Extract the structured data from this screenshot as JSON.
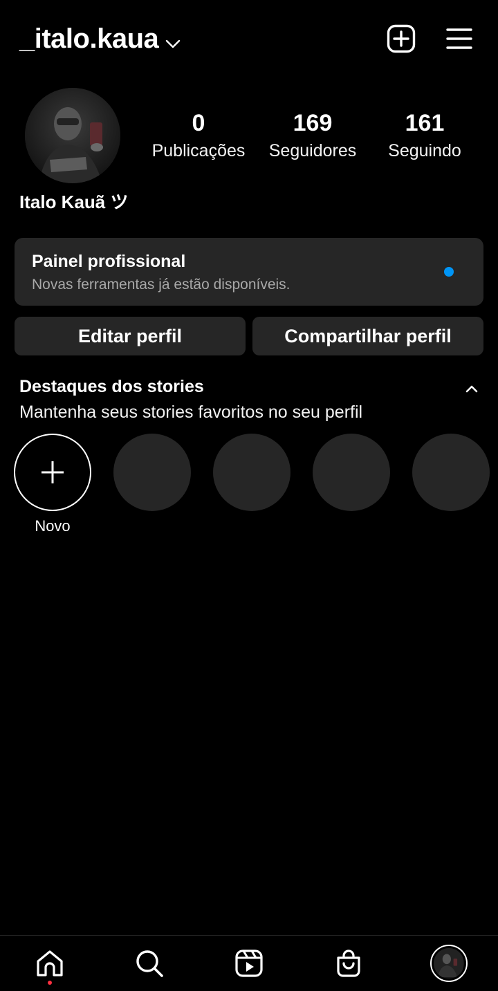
{
  "header": {
    "username": "_italo.kaua",
    "dropdown_icon": "chevron-down-icon",
    "create_icon": "plus-square-icon",
    "menu_icon": "hamburger-menu-icon"
  },
  "profile": {
    "full_name": "Italo Kauã ツ",
    "stats": [
      {
        "value": "0",
        "label": "Publicações"
      },
      {
        "value": "169",
        "label": "Seguidores"
      },
      {
        "value": "161",
        "label": "Seguindo"
      }
    ]
  },
  "professional_panel": {
    "title": "Painel profissional",
    "subtitle": "Novas ferramentas já estão disponíveis.",
    "dot_color": "#0095f6"
  },
  "actions": {
    "edit_label": "Editar perfil",
    "share_label": "Compartilhar perfil"
  },
  "highlights": {
    "title": "Destaques dos stories",
    "subtitle": "Mantenha seus stories favoritos no seu perfil",
    "new_label": "Novo"
  },
  "bottom_nav": {
    "items": [
      "home-icon",
      "search-icon",
      "reels-icon",
      "shop-icon",
      "profile-avatar"
    ],
    "notification_color": "#ff3040"
  },
  "colors": {
    "background": "#000000",
    "surface": "#262626",
    "secondary_text": "#a8a8a8"
  }
}
